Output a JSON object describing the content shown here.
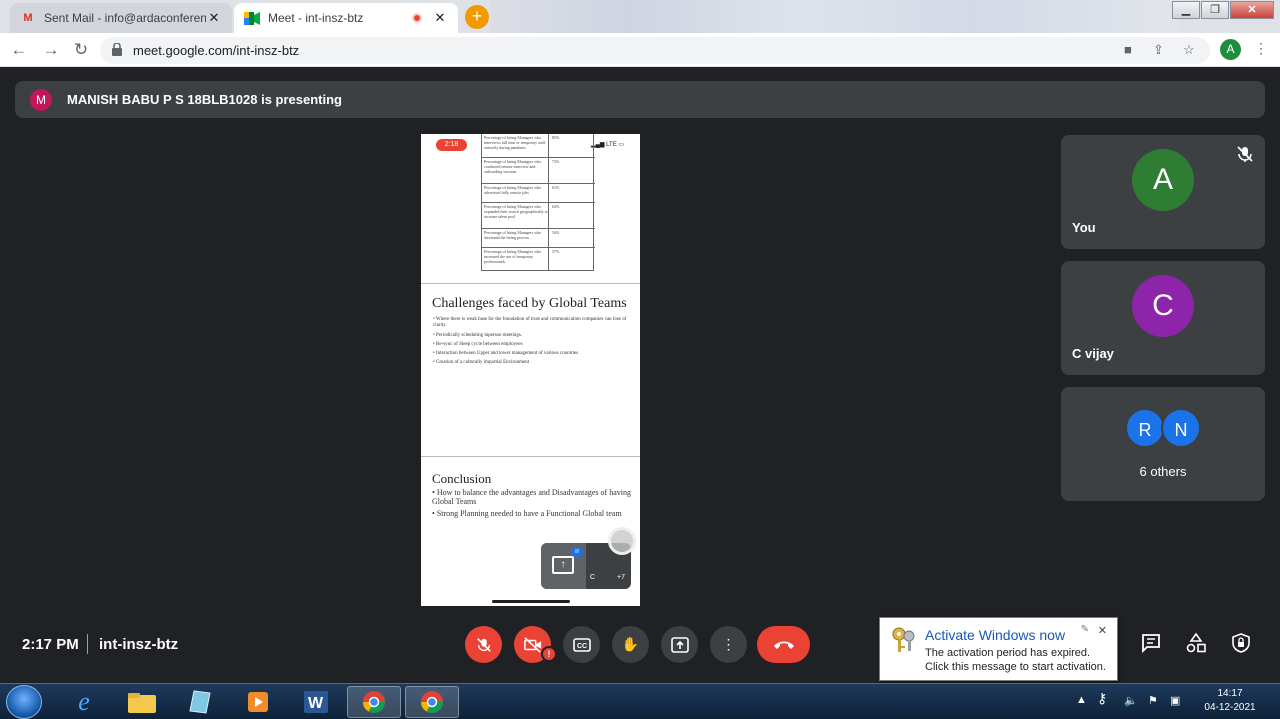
{
  "browser": {
    "tabs": [
      {
        "title": "Sent Mail - info@ardaconference",
        "favicon": "gmail-icon"
      },
      {
        "title": "Meet - int-insz-btz",
        "favicon": "meet-icon"
      }
    ],
    "url": "meet.google.com/int-insz-btz",
    "profile_initial": "A"
  },
  "meet": {
    "presenter": {
      "initial": "M",
      "text": "MANISH BABU P S 18BLB1028 is presenting"
    },
    "time": "2:17 PM",
    "meeting_code": "int-insz-btz",
    "participants": [
      {
        "initial": "A",
        "name": "You",
        "color": "#2e7d32",
        "muted": true
      },
      {
        "initial": "C",
        "name": "C vijay",
        "color": "#8e24aa"
      }
    ],
    "others": {
      "initials": [
        "R",
        "N"
      ],
      "label": "6 others"
    }
  },
  "slide": {
    "status_time": "2:18",
    "status_network": "LTE",
    "table_rows": [
      {
        "label": "Percentage of hiring Managers who interviews full time or temporary staff remotely during pandemic",
        "value": "85%"
      },
      {
        "label": "Percentage of hiring Managers who conducted remote interview and onboarding sessions",
        "value": "73%"
      },
      {
        "label": "Percentage of hiring Managers who advertised fully remote jobs",
        "value": "61%"
      },
      {
        "label": "Percentage of hiring Managers who expanded their search geographically to increase talent pool",
        "value": "64%"
      },
      {
        "label": "Percentage of hiring Managers who shortened the hiring process",
        "value": "54%"
      },
      {
        "label": "Percentage of hiring Managers who increased the use of temporary professionals",
        "value": "57%"
      }
    ],
    "challenges_title": "Challenges faced by Global Teams",
    "challenges": [
      "Where there is weak base for the foundation of trust and communication companies can lose of clarity.",
      "Periodically scheduling inperson meetings.",
      "Re-sync of Sleep cycle between employees",
      "Interaction between Upper and lower management of various countries",
      "Creation of a culturally impartial Environment"
    ],
    "conclusion_title": "Conclusion",
    "conclusion": [
      "How to balance the advantages and Disadvantages of having Global Teams",
      "Strong Planning needed to have a Functional Global team"
    ],
    "mini_self": "C",
    "mini_count": "+7"
  },
  "notification": {
    "title": "Activate Windows now",
    "line1": "The activation period has expired.",
    "line2": "Click this message to start activation."
  },
  "taskbar": {
    "time": "14:17",
    "date": "04-12-2021"
  }
}
